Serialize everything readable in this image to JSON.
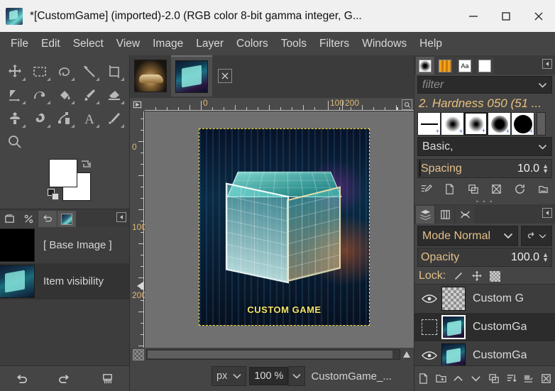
{
  "window": {
    "title": "*[CustomGame] (imported)-2.0 (RGB color 8-bit gamma integer, G...",
    "minimize_label": "Minimize",
    "maximize_label": "Maximize",
    "close_label": "Close"
  },
  "menubar": {
    "items": [
      {
        "label": "File"
      },
      {
        "label": "Edit"
      },
      {
        "label": "Select"
      },
      {
        "label": "View"
      },
      {
        "label": "Image"
      },
      {
        "label": "Layer"
      },
      {
        "label": "Colors"
      },
      {
        "label": "Tools"
      },
      {
        "label": "Filters"
      },
      {
        "label": "Windows"
      },
      {
        "label": "Help"
      }
    ]
  },
  "toolbox": {
    "tools": [
      {
        "name": "move-tool"
      },
      {
        "name": "rectangle-select-tool"
      },
      {
        "name": "free-select-tool"
      },
      {
        "name": "fuzzy-select-tool"
      },
      {
        "name": "crop-tool"
      },
      {
        "name": "transform-tool"
      },
      {
        "name": "warp-transform-tool"
      },
      {
        "name": "bucket-fill-tool"
      },
      {
        "name": "paintbrush-tool"
      },
      {
        "name": "eraser-tool"
      },
      {
        "name": "clone-tool"
      },
      {
        "name": "smudge-tool"
      },
      {
        "name": "paths-tool"
      },
      {
        "name": "text-tool"
      },
      {
        "name": "color-picker-tool"
      },
      {
        "name": "zoom-tool"
      }
    ],
    "foreground_color": "#ffffff",
    "background_color": "#ffffff"
  },
  "history": {
    "tabs": [
      {
        "name": "tab-images"
      },
      {
        "name": "tab-device-status"
      },
      {
        "name": "tab-undo-history"
      },
      {
        "name": "tab-image-thumb"
      }
    ],
    "entries": [
      {
        "label": "[ Base Image ]",
        "has_thumb": false
      },
      {
        "label": "Item visibility",
        "has_thumb": true
      }
    ],
    "buttons": [
      {
        "name": "undo-button"
      },
      {
        "name": "redo-button"
      },
      {
        "name": "clear-history-button"
      }
    ]
  },
  "image_tabs": [
    {
      "name": "image-tab-car",
      "kind": "car",
      "active": false
    },
    {
      "name": "image-tab-customgame",
      "kind": "cube",
      "active": true
    }
  ],
  "rulers": {
    "horizontal_labels": [
      "0",
      "100",
      "200"
    ],
    "vertical_labels": [
      "0",
      "100",
      "200"
    ],
    "unit": "px"
  },
  "canvas": {
    "caption": "CUSTOM GAME",
    "selection_color": "#f5e032"
  },
  "statusbar": {
    "unit": "px",
    "zoom": "100 %",
    "filename": "CustomGame_..."
  },
  "brushes": {
    "tabs": [
      {
        "name": "tab-brushes"
      },
      {
        "name": "tab-gradients"
      },
      {
        "name": "tab-fonts"
      },
      {
        "name": "tab-documents"
      }
    ],
    "filter_placeholder": "filter",
    "active_brush": "2. Hardness 050 (51 ...",
    "presets": [
      {
        "name": "brush-preset-line",
        "shape": "line"
      },
      {
        "name": "brush-preset-soft",
        "shape": "soft"
      },
      {
        "name": "brush-preset-hardness-050",
        "shape": "soft"
      },
      {
        "name": "brush-preset-mid",
        "shape": "mid"
      },
      {
        "name": "brush-preset-hard",
        "shape": "hard"
      }
    ],
    "category": "Basic,",
    "spacing_label": "Spacing",
    "spacing_value": "10.0",
    "buttons": [
      {
        "name": "edit-brush-button"
      },
      {
        "name": "new-brush-button"
      },
      {
        "name": "duplicate-brush-button"
      },
      {
        "name": "delete-brush-button"
      },
      {
        "name": "refresh-brushes-button"
      },
      {
        "name": "open-brush-as-image-button"
      }
    ]
  },
  "layers": {
    "tabs": [
      {
        "name": "tab-layers"
      },
      {
        "name": "tab-channels"
      },
      {
        "name": "tab-paths"
      }
    ],
    "mode_label": "Mode Normal",
    "opacity_label": "Opacity",
    "opacity_value": "100.0",
    "lock_label": "Lock:",
    "lock_icons": [
      {
        "name": "lock-pixels-icon"
      },
      {
        "name": "lock-position-icon"
      },
      {
        "name": "lock-alpha-icon"
      }
    ],
    "rows": [
      {
        "name": "Custom G",
        "visible": true,
        "selected": false,
        "thumb": "alpha"
      },
      {
        "name": "CustomGa",
        "visible": false,
        "selected": true,
        "thumb": "pic"
      },
      {
        "name": "CustomGa",
        "visible": true,
        "selected": false,
        "thumb": "pic"
      }
    ],
    "buttons": [
      {
        "name": "new-layer-button"
      },
      {
        "name": "new-layer-group-button"
      },
      {
        "name": "raise-layer-button"
      },
      {
        "name": "lower-layer-button"
      },
      {
        "name": "duplicate-layer-button"
      },
      {
        "name": "merge-down-button"
      },
      {
        "name": "anchor-layer-button"
      },
      {
        "name": "delete-layer-button"
      }
    ]
  }
}
